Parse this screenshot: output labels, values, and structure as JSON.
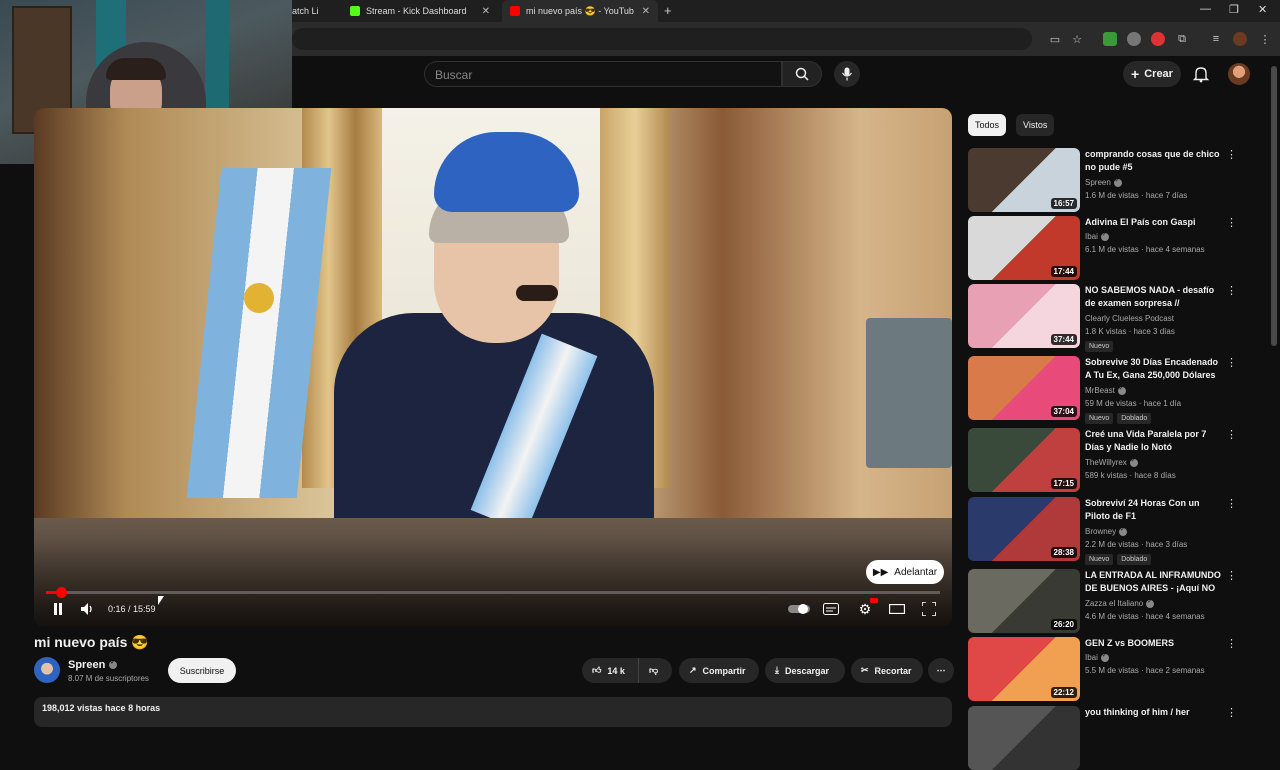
{
  "browser": {
    "tabs": [
      {
        "label": "atch Li",
        "favicon_color": "#9146ff",
        "active": false
      },
      {
        "label": "Stream - Kick Dashboard",
        "favicon_color": "#53fc18",
        "active": false
      },
      {
        "label": "mi nuevo país 😎 - YouTub",
        "favicon_color": "#ff0000",
        "active": true
      }
    ],
    "new_tab_glyph": "+",
    "window_controls": [
      "—",
      "❐",
      "✕"
    ]
  },
  "youtube_header": {
    "search_placeholder": "Buscar",
    "create_label": "Crear"
  },
  "player": {
    "current_time": "0:16",
    "duration": "15:59",
    "time_display": "0:16 / 15:59",
    "progress_fraction": 0.017,
    "skip_label": "Adelantar"
  },
  "video": {
    "title": "mi nuevo país 😎",
    "channel": "Spreen",
    "subscribers": "8.07 M de suscriptores",
    "subscribe_label": "Suscribirse",
    "likes": "14 k",
    "share_label": "Compartir",
    "download_label": "Descargar",
    "clip_label": "Recortar",
    "views_date": "198,012 vistas  hace 8 horas"
  },
  "sidebar": {
    "chips": [
      "Todos",
      "Vistos"
    ],
    "recommendations": [
      {
        "title": "comprando cosas que de chico no pude #5",
        "channel": "Spreen",
        "verified": true,
        "meta": "1.6 M de vistas · hace 7 días",
        "duration": "16:57",
        "badges": [],
        "thumb_colors": [
          "#4a3a30",
          "#c8d3dc"
        ]
      },
      {
        "title": "Adivina El País con Gaspi",
        "channel": "Ibai",
        "verified": true,
        "meta": "6.1 M de vistas · hace 4 semanas",
        "duration": "17:44",
        "badges": [],
        "thumb_colors": [
          "#d9d9d9",
          "#c0392b"
        ]
      },
      {
        "title": "NO SABEMOS NADA - desafío de examen sorpresa // episodi...",
        "channel": "Clearly Clueless Podcast",
        "verified": false,
        "meta": "1.8 K vistas · hace 3 días",
        "duration": "37:44",
        "badges": [
          "Nuevo"
        ],
        "thumb_colors": [
          "#e8a0b4",
          "#f5d5de"
        ]
      },
      {
        "title": "Sobrevive 30 Días Encadenado A Tu Ex, Gana 250,000 Dólares",
        "channel": "MrBeast",
        "verified": true,
        "meta": "59 M de vistas · hace 1 día",
        "duration": "37:04",
        "badges": [
          "Nuevo",
          "Doblado"
        ],
        "thumb_colors": [
          "#d97a4a",
          "#e84a7a"
        ]
      },
      {
        "title": "Creé una Vida Paralela por 7 Días y Nadie lo Notó",
        "channel": "TheWillyrex",
        "verified": true,
        "meta": "589 k vistas · hace 8 días",
        "duration": "17:15",
        "badges": [],
        "thumb_colors": [
          "#3a4a3a",
          "#c04040"
        ]
      },
      {
        "title": "Sobreviví 24 Horas Con un Piloto de F1",
        "channel": "Browney",
        "verified": true,
        "meta": "2.2 M de vistas · hace 3 días",
        "duration": "28:38",
        "badges": [
          "Nuevo",
          "Doblado"
        ],
        "thumb_colors": [
          "#2a3a6a",
          "#b03a3a"
        ]
      },
      {
        "title": "LA ENTRADA AL INFRAMUNDO DE BUENOS AIRES - ¡Aquí NO ...",
        "channel": "Zazza el Italiano",
        "verified": true,
        "meta": "4.6 M de vistas · hace 4 semanas",
        "duration": "26:20",
        "badges": [],
        "thumb_colors": [
          "#6a6a60",
          "#3a3a34"
        ]
      },
      {
        "title": "GEN Z vs BOOMERS",
        "channel": "Ibai",
        "verified": true,
        "meta": "5.5 M de vistas · hace 2 semanas",
        "duration": "22:12",
        "badges": [],
        "thumb_colors": [
          "#e04848",
          "#f0a050"
        ]
      },
      {
        "title": "you thinking of him / her",
        "channel": "",
        "verified": false,
        "meta": "",
        "duration": "",
        "badges": [],
        "thumb_colors": [
          "#555",
          "#333"
        ]
      }
    ]
  },
  "colors": {
    "accent": "#ff0000",
    "bg": "#0f0f0f",
    "surface": "#272727"
  }
}
